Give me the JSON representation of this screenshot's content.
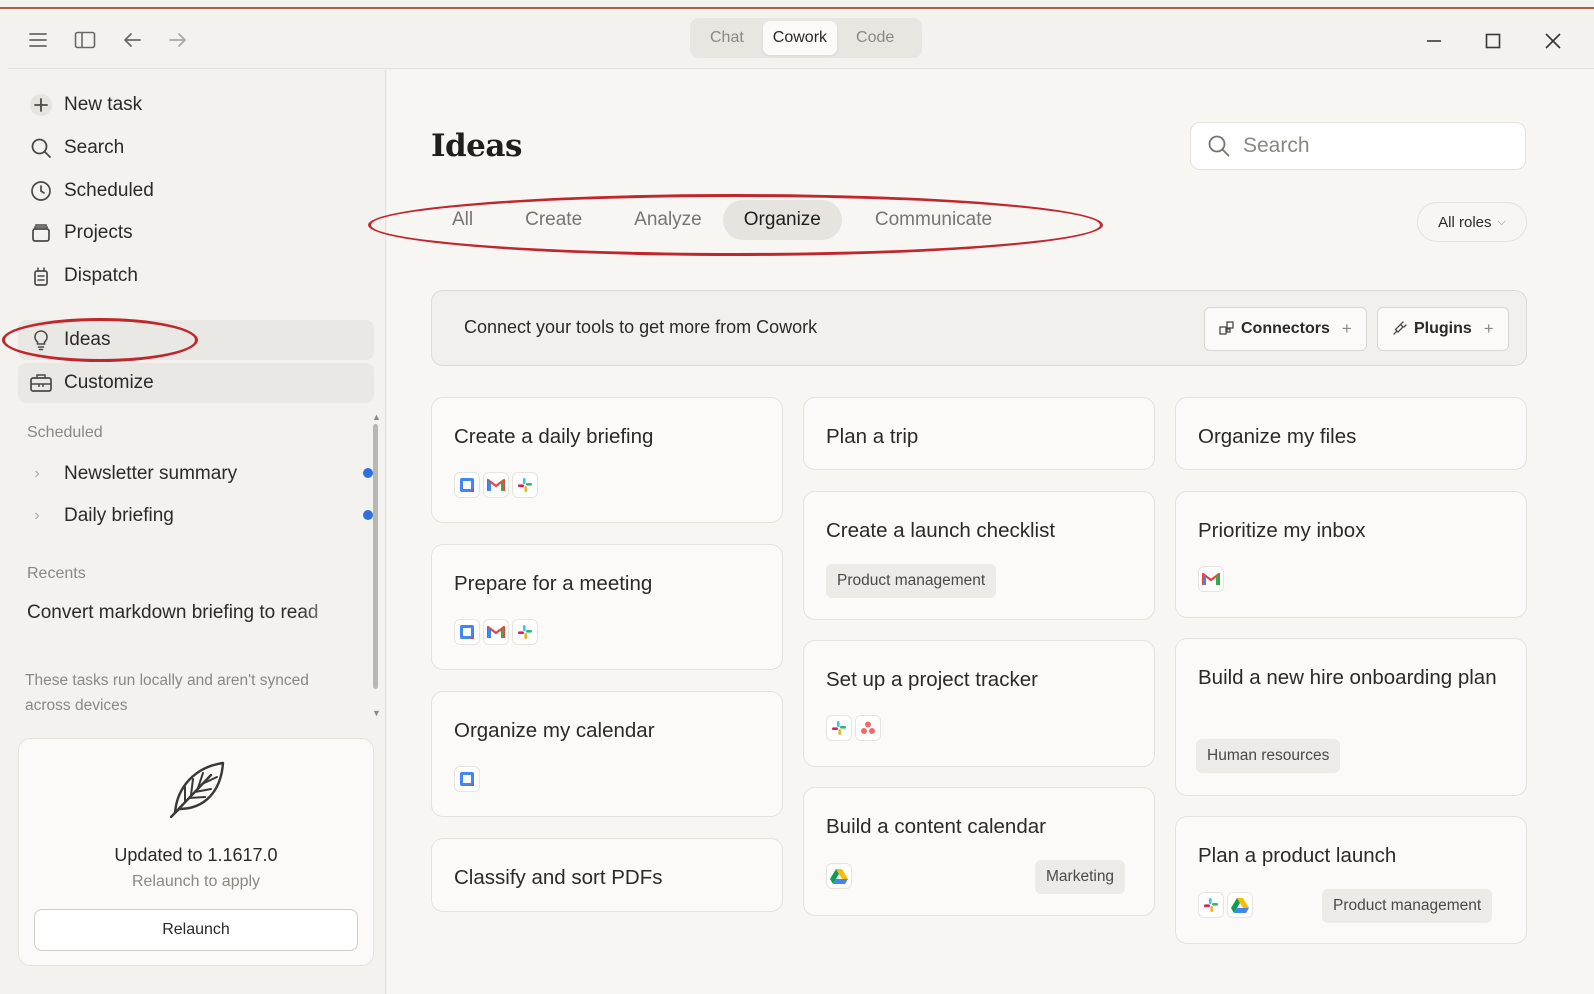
{
  "window": {
    "modes": [
      "Chat",
      "Cowork",
      "Code"
    ],
    "active_mode": "Cowork"
  },
  "sidebar": {
    "nav": [
      {
        "label": "New task",
        "icon": "plus-icon"
      },
      {
        "label": "Search",
        "icon": "search-icon"
      },
      {
        "label": "Scheduled",
        "icon": "clock-icon"
      },
      {
        "label": "Projects",
        "icon": "folder-icon"
      },
      {
        "label": "Dispatch",
        "icon": "dispatch-icon"
      },
      {
        "label": "Ideas",
        "icon": "lightbulb-icon"
      },
      {
        "label": "Customize",
        "icon": "toolbox-icon"
      }
    ],
    "scheduled_label": "Scheduled",
    "scheduled": [
      {
        "label": "Newsletter summary"
      },
      {
        "label": "Daily briefing"
      }
    ],
    "recents_label": "Recents",
    "recents": [
      {
        "label": "Convert markdown briefing to read"
      }
    ],
    "note": "These tasks run locally and aren't synced across devices",
    "update": {
      "title": "Updated to 1.1617.0",
      "subtitle": "Relaunch to apply",
      "button": "Relaunch"
    }
  },
  "main": {
    "title": "Ideas",
    "search_placeholder": "Search",
    "tabs": [
      "All",
      "Create",
      "Analyze",
      "Organize",
      "Communicate"
    ],
    "active_tab": "Organize",
    "roles_label": "All roles",
    "connect": {
      "text": "Connect your tools to get more from Cowork",
      "connectors": "Connectors",
      "plugins": "Plugins"
    },
    "cards": [
      {
        "title": "Create a daily briefing",
        "apps": [
          "calendar",
          "gmail",
          "slack"
        ]
      },
      {
        "title": "Prepare for a meeting",
        "apps": [
          "calendar",
          "gmail",
          "slack"
        ]
      },
      {
        "title": "Organize my calendar",
        "apps": [
          "calendar"
        ]
      },
      {
        "title": "Classify and sort PDFs",
        "apps": []
      },
      {
        "title": "Plan a trip",
        "apps": []
      },
      {
        "title": "Create a launch checklist",
        "tag": "Product management"
      },
      {
        "title": "Set up a project tracker",
        "apps": [
          "slack",
          "asana"
        ]
      },
      {
        "title": "Build a content calendar",
        "apps": [
          "drive"
        ],
        "tag": "Marketing"
      },
      {
        "title": "Organize my files",
        "apps": []
      },
      {
        "title": "Prioritize my inbox",
        "apps": [
          "gmail"
        ]
      },
      {
        "title": "Build a new hire onboarding plan",
        "tag": "Human resources"
      },
      {
        "title": "Plan a product launch",
        "apps": [
          "slack",
          "drive"
        ],
        "tag": "Product management"
      }
    ]
  },
  "colors": {
    "annotation_red": "#c0262c",
    "unread_dot": "#2f6fde",
    "background": "#f7f6f3"
  }
}
